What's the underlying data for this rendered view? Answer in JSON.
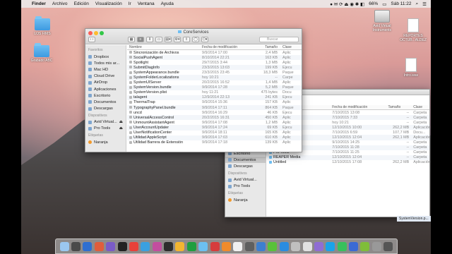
{
  "menubar": {
    "app": "Finder",
    "menus": [
      "Archivo",
      "Edición",
      "Visualización",
      "Ir",
      "Ventana",
      "Ayuda"
    ],
    "battery": "66%",
    "clock": "Sáb 11:22"
  },
  "desktop_icons": [
    {
      "label": "LOS FIMS"
    },
    {
      "label": "Grabado ABC"
    },
    {
      "label": "Avid Virtual Instruments"
    },
    {
      "label": "REPORTES OCTUB...ALDEZ"
    },
    {
      "label": "Intro.wav"
    }
  ],
  "front_window": {
    "title": "CoreServices",
    "search_placeholder": "Buscar",
    "sidebar": {
      "favorites_header": "Favoritos",
      "favorites": [
        "Dropbox",
        "Todos mis ar...",
        "Mac HD",
        "Cloud Drive",
        "AirDrop",
        "Aplicaciones",
        "Escritorio",
        "Documentos",
        "Descargas"
      ],
      "devices_header": "Dispositivos",
      "devices": [
        "Avid Virtual...",
        "Pro Tools"
      ],
      "tags_header": "Etiquetas",
      "tags": [
        "Naranja"
      ]
    },
    "columns": [
      "Nombre",
      "Fecha de modificación",
      "Tamaño",
      "Clase"
    ],
    "rows": [
      {
        "name": "Sincronización de Archivos",
        "date": "9/9/2014 17:00",
        "size": "2,4 MB",
        "kind": "Aplic"
      },
      {
        "name": "SocialPushAgent",
        "date": "8/10/2014 22:21",
        "size": "163 KB",
        "kind": "Aplic"
      },
      {
        "name": "Spotlight",
        "date": "29/7/2015 3:44",
        "size": "1,3 MB",
        "kind": "Aplic"
      },
      {
        "name": "SubmitDiagInfo",
        "date": "23/3/2015 13:03",
        "size": "199 KB",
        "kind": "Ejecu"
      },
      {
        "name": "SystemAppearance.bundle",
        "date": "23/3/2015 23:45",
        "size": "18,3 MB",
        "kind": "Paque"
      },
      {
        "name": "SystemFolderLocalizations",
        "date": "hoy 10:21",
        "size": "--",
        "kind": "Carpe"
      },
      {
        "name": "SystemUIServer",
        "date": "20/2/2015 16:52",
        "size": "1,4 MB",
        "kind": "Aplic"
      },
      {
        "name": "SystemVersion.bundle",
        "date": "9/9/2014 17:28",
        "size": "5,2 MB",
        "kind": "Paque"
      },
      {
        "name": "SystemVersion.plist",
        "date": "hoy 11:21",
        "size": "475 bytes",
        "kind": "Docu"
      },
      {
        "name": "talagent",
        "date": "12/9/2014 22:13",
        "size": "241 KB",
        "kind": "Ejecu"
      },
      {
        "name": "ThermalTrap",
        "date": "9/9/2014 15:36",
        "size": "157 KB",
        "kind": "Aplic"
      },
      {
        "name": "TypographyPanel.bundle",
        "date": "9/9/2014 17:11",
        "size": "864 KB",
        "kind": "Paque"
      },
      {
        "name": "uncd",
        "date": "9/9/2014 16:29",
        "size": "46 KB",
        "kind": "Ejecu"
      },
      {
        "name": "UniversalAccessControl",
        "date": "20/2/2015 16:31",
        "size": "450 KB",
        "kind": "Aplic"
      },
      {
        "name": "UnmountAssistantAgent",
        "date": "9/9/2014 17:08",
        "size": "1,2 MB",
        "kind": "Aplic"
      },
      {
        "name": "UserAccountUpdater",
        "date": "9/9/2014 17:24",
        "size": "69 KB",
        "kind": "Ejecu"
      },
      {
        "name": "UserNotificationCenter",
        "date": "9/9/2014 18:11",
        "size": "165 KB",
        "kind": "Aplic"
      },
      {
        "name": "Utilidad AppleScript",
        "date": "9/9/2014 17:03",
        "size": "610 KB",
        "kind": "Aplic"
      },
      {
        "name": "Utilidad Barrera de Extensión",
        "date": "9/9/2014 17:18",
        "size": "139 KB",
        "kind": "Aplic"
      }
    ]
  },
  "back_window": {
    "sidebar": {
      "items": [
        "Escritorio",
        "Documentos",
        "Descargas"
      ],
      "devices_header": "Dispositivos",
      "devices": [
        "Avid Virtual...",
        "Pro Tools"
      ],
      "tags_header": "Etiquetas",
      "tags": [
        "Naranja"
      ]
    },
    "columns": [
      "Fecha de modificación",
      "Tamaño",
      "Clase"
    ],
    "rows": [
      {
        "name": "",
        "date": "7/10/2015 13:08",
        "size": "--",
        "kind": "Carpeta"
      },
      {
        "name": "Microsoft",
        "date": "7/10/2015 7:33",
        "size": "--",
        "kind": "Carpeta"
      },
      {
        "name": "",
        "date": "hoy 10:21",
        "size": "--",
        "kind": "Carpeta"
      },
      {
        "name": "",
        "date": "12/10/2015 10:00",
        "size": "262,2 MB",
        "kind": "Aplicación"
      },
      {
        "name": "",
        "date": "7/10/2015 6:59",
        "size": "107,7 MB",
        "kind": "Docu..."
      },
      {
        "name": "",
        "date": "12/10/2015 12:04",
        "size": "262,1 MB",
        "kind": "Aplicación"
      },
      {
        "name": "",
        "date": "9/10/2015 14:25",
        "size": "--",
        "kind": "Carpeta"
      },
      {
        "name": "...ents",
        "date": "7/10/2015 11:28",
        "size": "--",
        "kind": "Carpeta"
      },
      {
        "name": "Pro Tools",
        "date": "7/10/2015 11:25",
        "size": "--",
        "kind": "Carpeta"
      },
      {
        "name": "REAPER Media",
        "date": "12/10/2015 12:04",
        "size": "--",
        "kind": "Carpeta"
      },
      {
        "name": "Untitled",
        "date": "12/10/2015 17:08",
        "size": "262,2 MB",
        "kind": "Aplicación"
      }
    ]
  },
  "dock": {
    "icon_colors": [
      "#9bc7ef",
      "#4a4a4a",
      "#2f6fd0",
      "#e05d3b",
      "#7a5bc6",
      "#222222",
      "#e7413a",
      "#3aa0e0",
      "#c34e9f",
      "#2d2d2d",
      "#f2b530",
      "#1f9e3f",
      "#6cc0f0",
      "#d63c3c",
      "#ef8b2c",
      "#f0f0f0",
      "#5f5f5f",
      "#3d7fcf",
      "#59c13a",
      "#2a8ce0",
      "#c0c0c0",
      "#e1e1e1",
      "#8f6dd3",
      "#1aa3e8",
      "#38c05c",
      "#3a6ad4",
      "#7fbd3a",
      "#999999",
      "#555555"
    ]
  },
  "bottom_tag": "SystemVersion.p..."
}
